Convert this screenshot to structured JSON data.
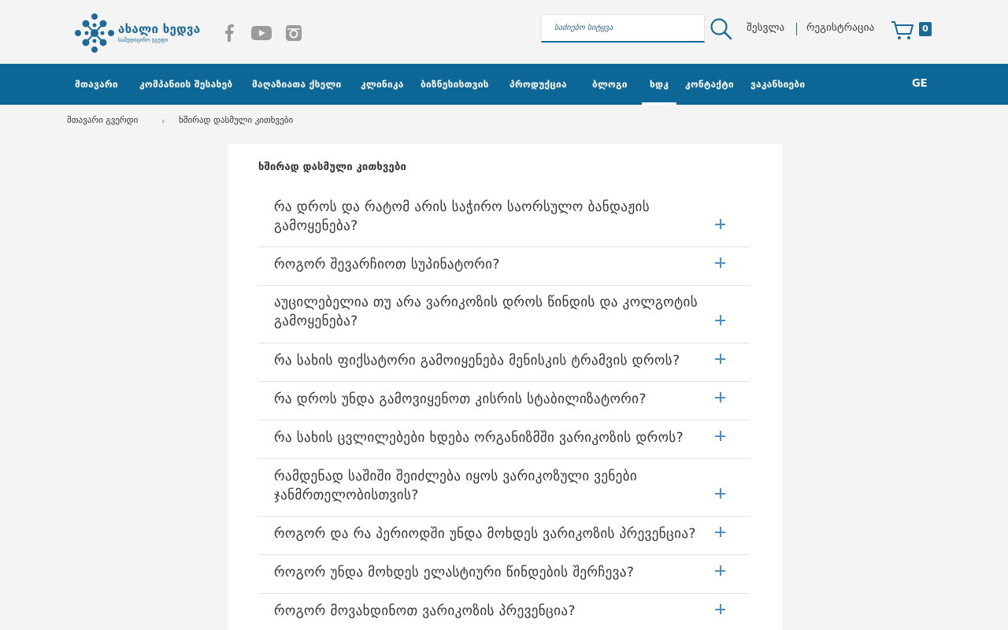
{
  "header": {
    "logo_title": "ახალი ხედვა",
    "logo_subtitle": "სამედიცინო ჯგუფი",
    "social": [
      "facebook-icon",
      "youtube-icon",
      "instagram-icon"
    ],
    "search_placeholder": "საძიებო სიტყვა",
    "login_label": "შესვლა",
    "register_label": "რეგისტრაცია",
    "cart_count": "0"
  },
  "nav": {
    "items": [
      {
        "label": "მთავარი",
        "active": false
      },
      {
        "label": "კომპანიის შესახებ",
        "active": false
      },
      {
        "label": "მაღაზიათა ქსელი",
        "active": false
      },
      {
        "label": "კლინიკა",
        "active": false
      },
      {
        "label": "ბიზნესისთვის",
        "active": false
      },
      {
        "label": "პროდუქცია",
        "active": false
      },
      {
        "label": "ბლოგი",
        "active": false
      },
      {
        "label": "ხდკ",
        "active": true
      },
      {
        "label": "კონტაქტი",
        "active": false
      },
      {
        "label": "ვაკანსიები",
        "active": false
      }
    ],
    "lang": "GE"
  },
  "breadcrumb": {
    "home": "მთავარი გვერდი",
    "current": "ხშირად დასმული კითხვები"
  },
  "page": {
    "title": "ხშირად დასმული კითხვები"
  },
  "faq": [
    "რა დროს და რატომ არის საჭირო საორსულო ბანდაჟის გამოყენება?",
    "როგორ შევარჩიოთ სუპინატორი?",
    "აუცილებელია თუ არა ვარიკოზის დროს წინდის და კოლგოტის გამოყენება?",
    "რა სახის ფიქსატორი გამოიყენება მენისკის ტრამვის დროს?",
    "რა დროს უნდა გამოვიყენოთ კისრის სტაბილიზატორი?",
    "რა სახის ცვლილებები ხდება ორგანიზმში ვარიკოზის დროს?",
    "რამდენად საშიში შეიძლება იყოს ვარიკოზული ვენები ჯანმრთელობისთვის?",
    "როგორ და რა პერიოდში უნდა მოხდეს ვარიკოზის პრევენცია?",
    "როგორ უნდა მოხდეს ელასტიური წინდების შერჩევა?",
    "როგორ მოვახდინოთ ვარიკოზის პრევენცია?"
  ],
  "colors": {
    "brand_blue": "#0d6796",
    "accent_blue": "#1a6a98",
    "plus_blue": "#4a8fc0"
  }
}
